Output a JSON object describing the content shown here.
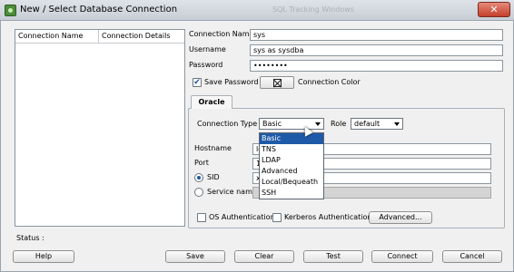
{
  "window": {
    "title": "New / Select Database Connection",
    "background_title": "SQL Tracking Windows",
    "close_glyph": "✕"
  },
  "connections_table": {
    "headers": [
      "Connection Name",
      "Connection Details"
    ]
  },
  "form": {
    "connection_name_label": "Connection Name",
    "connection_name_value": "sys",
    "username_label": "Username",
    "username_value": "sys as sysdba",
    "password_label": "Password",
    "password_value": "••••••••",
    "save_password_label": "Save Password",
    "save_password_checked": true,
    "save_password_check_glyph": "✔",
    "connection_color_label": "Connection Color"
  },
  "oracle_tab": {
    "tab_label": "Oracle",
    "connection_type_label": "Connection Type",
    "connection_type_value": "Basic",
    "connection_type_options": [
      "Basic",
      "TNS",
      "LDAP",
      "Advanced",
      "Local/Bequeath",
      "SSH"
    ],
    "role_label": "Role",
    "role_value": "default",
    "hostname_label": "Hostname",
    "hostname_value": "lo",
    "port_label": "Port",
    "port_value": "1",
    "sid_label": "SID",
    "sid_value": "x",
    "service_name_label": "Service name",
    "sid_selected": true,
    "os_auth_label": "OS Authentication",
    "kerberos_auth_label": "Kerberos Authentication",
    "advanced_button": "Advanced..."
  },
  "status": {
    "label": "Status :"
  },
  "buttons": {
    "help": "Help",
    "save": "Save",
    "clear": "Clear",
    "test": "Test",
    "connect": "Connect",
    "cancel": "Cancel"
  },
  "icons": {
    "app": "sql-developer-app-icon",
    "close": "close-icon",
    "color_picker": "color-swatch-icon",
    "dropdown": "chevron-down-icon",
    "cursor": "mouse-pointer-icon"
  },
  "colors": {
    "selection": "#1e5aa8",
    "close_button": "#c4402c"
  }
}
